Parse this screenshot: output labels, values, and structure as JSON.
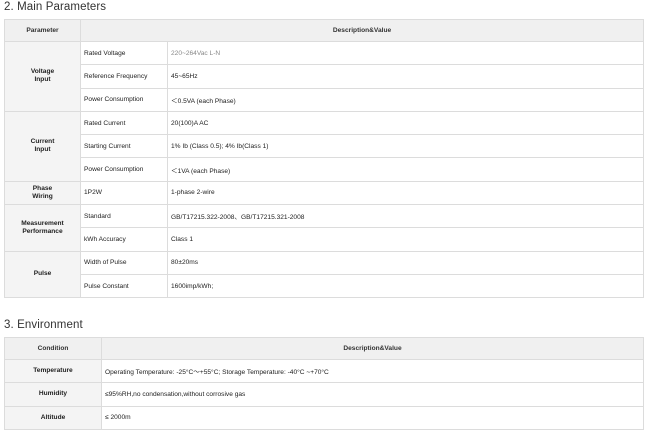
{
  "main_section": {
    "title": "2. Main Parameters",
    "header": {
      "parameter": "Parameter",
      "description": "Description&Value"
    },
    "groups": [
      {
        "label": "Voltage\nInput",
        "rows": [
          {
            "name": "Rated Voltage",
            "value": "220~264Vac L-N"
          },
          {
            "name": "Reference Frequency",
            "value": "45~65Hz"
          },
          {
            "name": "Power Consumption",
            "value": "＜0.5VA (each Phase)"
          }
        ]
      },
      {
        "label": "Current\nInput",
        "rows": [
          {
            "name": "Rated Current",
            "value": "20(100)A AC"
          },
          {
            "name": "Starting Current",
            "value": "1% Ib (Class 0.5); 4% Ib(Class 1)"
          },
          {
            "name": "Power Consumption",
            "value": "＜1VA (each Phase)"
          }
        ]
      },
      {
        "label": "Phase\nWiring",
        "rows": [
          {
            "name": "1P2W",
            "value": "1-phase 2-wire"
          }
        ]
      },
      {
        "label": "Measurement\nPerformance",
        "rows": [
          {
            "name": "Standard",
            "value": "GB/T17215.322-2008、GB/T17215.321-2008"
          },
          {
            "name": "kWh Accuracy",
            "value": "Class 1"
          }
        ]
      },
      {
        "label": "Pulse",
        "rows": [
          {
            "name": "Width of Pulse",
            "value": "80±20ms"
          },
          {
            "name": "Pulse Constant",
            "value": "1600imp/kWh;"
          }
        ]
      }
    ]
  },
  "env_section": {
    "title": "3. Environment",
    "header": {
      "condition": "Condition",
      "description": "Description&Value"
    },
    "rows": [
      {
        "name": "Temperature",
        "value": "Operating Temperature: -25°C～+55°C;  Storage Temperature: -40°C ~+70°C"
      },
      {
        "name": "Humidity",
        "value": "≤95%RH,no condensation,without corrosive gas"
      },
      {
        "name": "Altitude",
        "value": "≤ 2000m"
      }
    ]
  }
}
